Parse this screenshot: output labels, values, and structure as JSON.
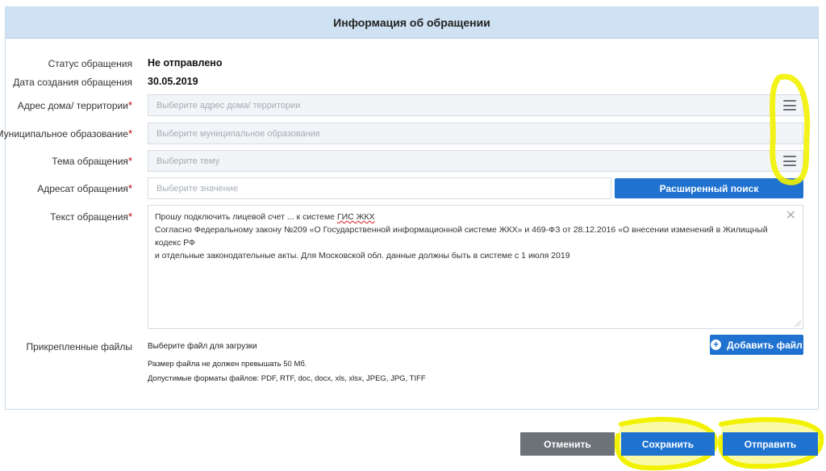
{
  "panel": {
    "title": "Информация об обращении"
  },
  "status": {
    "label": "Статус обращения",
    "value": "Не отправлено"
  },
  "created": {
    "label": "Дата создания обращения",
    "value": "30.05.2019"
  },
  "address": {
    "label": "Адрес дома/ территории",
    "required_mark": "*",
    "placeholder": "Выберите адрес дома/ территории"
  },
  "municipality": {
    "label": "Муниципальное образование",
    "required_mark": "*",
    "placeholder": "Выберите муниципальное образование"
  },
  "topic": {
    "label": "Тема обращения",
    "required_mark": "*",
    "placeholder": "Выберите тему"
  },
  "addressee": {
    "label": "Адресат обращения",
    "required_mark": "*",
    "placeholder": "Выберите значение",
    "search_button": "Расширенный поиск"
  },
  "text": {
    "label": "Текст обращения",
    "required_mark": "*",
    "line1_prefix": "Прошу подключить лицевой счет ... к системе ",
    "line1_ghk": "ГИС ЖКХ",
    "line2": "Согласно Федеральному закону  №209 «О Государственной информационной системе ЖКХ» и 469-ФЗ от 28.12.2016 «О внесении изменений в Жилищный кодекс РФ",
    "line3": "и отдельные законодательные акты. Для Московской обл. данные должны быть в системе с 1 июля 2019"
  },
  "files": {
    "label": "Прикрепленные файлы",
    "choose": "Выберите файл для загрузки",
    "size_note": "Размер файла не должен превышать 50 Мб.",
    "formats_note": "Допустимые форматы файлов: PDF, RTF, doc, docx, xls, xlsx, JPEG, JPG, TIFF",
    "add_button": "Добавить файл"
  },
  "actions": {
    "cancel": "Отменить",
    "save": "Сохранить",
    "send": "Отправить"
  },
  "colors": {
    "header_bg": "#cfe2f3",
    "primary": "#1f72d0",
    "cancel": "#6c7278",
    "highlight": "#f2f200",
    "required": "#c00000"
  },
  "icons": {
    "menu": "hamburger-icon",
    "close": "close-icon",
    "add": "plus-circle-icon"
  }
}
